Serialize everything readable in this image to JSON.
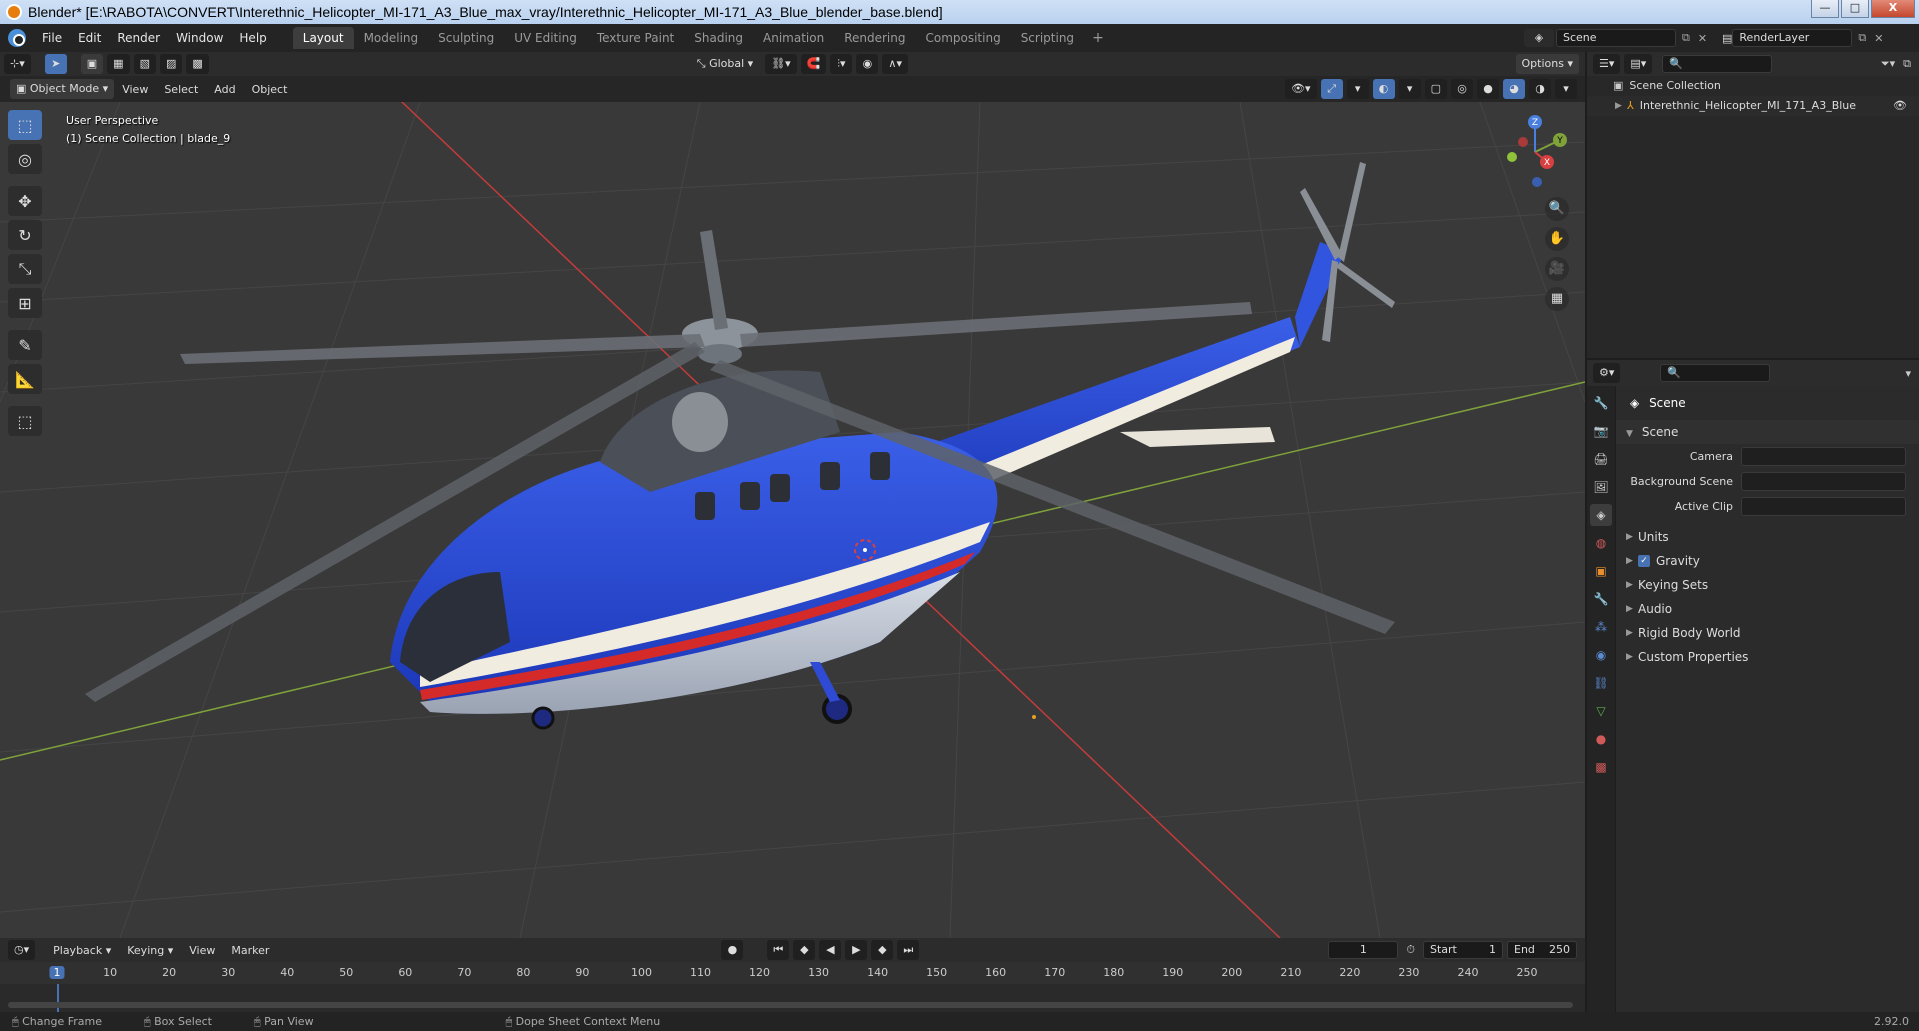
{
  "window": {
    "title": "Blender* [E:\\RABOTA\\CONVERT\\Interethnic_Helicopter_MI-171_A3_Blue_max_vray/Interethnic_Helicopter_MI-171_A3_Blue_blender_base.blend]",
    "min": "—",
    "max": "□",
    "close": "X"
  },
  "menu": {
    "items": [
      "File",
      "Edit",
      "Render",
      "Window",
      "Help"
    ],
    "workspaces": [
      "Layout",
      "Modeling",
      "Sculpting",
      "UV Editing",
      "Texture Paint",
      "Shading",
      "Animation",
      "Rendering",
      "Compositing",
      "Scripting"
    ],
    "add": "+"
  },
  "scene_selector": {
    "value": "Scene"
  },
  "renderlayer_selector": {
    "value": "RenderLayer"
  },
  "viewport_header": {
    "mode": "Object Mode",
    "menus": [
      "View",
      "Select",
      "Add",
      "Object"
    ],
    "transform": "Global",
    "options": "Options"
  },
  "viewport": {
    "perspective": "User Perspective",
    "collection_info": "(1) Scene Collection | blade_9",
    "gizmo_axes": [
      "Z",
      "Y",
      "X"
    ],
    "colors": {
      "background": "#393939",
      "x_axis": "#c43b3b",
      "y_axis": "#7fa33a",
      "grid": "#444444"
    }
  },
  "outliner": {
    "rows": [
      {
        "label": "Scene Collection"
      },
      {
        "label": "Interethnic_Helicopter_MI_171_A3_Blue"
      }
    ]
  },
  "properties": {
    "title": "Scene",
    "section": "Scene",
    "fields": [
      {
        "label": "Camera"
      },
      {
        "label": "Background Scene"
      },
      {
        "label": "Active Clip"
      }
    ],
    "panels": [
      {
        "label": "Units",
        "checkbox": false
      },
      {
        "label": "Gravity",
        "checkbox": true
      },
      {
        "label": "Keying Sets",
        "checkbox": false
      },
      {
        "label": "Audio",
        "checkbox": false
      },
      {
        "label": "Rigid Body World",
        "checkbox": false
      },
      {
        "label": "Custom Properties",
        "checkbox": false
      }
    ]
  },
  "timeline": {
    "menus": [
      "Playback",
      "Keying",
      "View",
      "Marker"
    ],
    "current_frame": "1",
    "start_label": "Start",
    "start": "1",
    "end_label": "End",
    "end": "250",
    "ruler": [
      "1",
      "10",
      "20",
      "30",
      "40",
      "50",
      "60",
      "70",
      "80",
      "90",
      "100",
      "110",
      "120",
      "130",
      "140",
      "150",
      "160",
      "170",
      "180",
      "190",
      "200",
      "210",
      "220",
      "230",
      "240",
      "250"
    ]
  },
  "statusbar": {
    "items": [
      "Change Frame",
      "Box Select",
      "Pan View",
      "Dope Sheet Context Menu"
    ],
    "version": "2.92.0"
  }
}
